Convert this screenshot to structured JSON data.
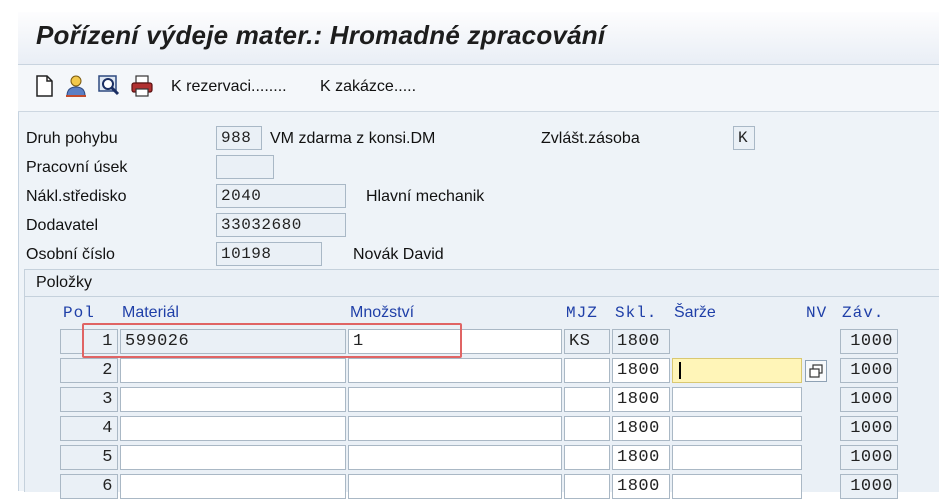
{
  "title": "Pořízení výdeje mater.: Hromadné zpracování",
  "toolbar": {
    "icons": [
      "new-document-icon",
      "person-icon",
      "find-icon",
      "printer-icon"
    ],
    "link_reservation": "K rezervaci........",
    "link_order": "K zakázce....."
  },
  "header": {
    "movement_type": {
      "label": "Druh pohybu",
      "value": "988",
      "text": "VM zdarma z konsi.DM"
    },
    "special_stock": {
      "label": "Zvlášt.zásoba",
      "value": "K"
    },
    "work_section": {
      "label": "Pracovní úsek",
      "value": ""
    },
    "cost_center": {
      "label": "Nákl.středisko",
      "value": "2040",
      "text": "Hlavní mechanik"
    },
    "supplier": {
      "label": "Dodavatel",
      "value": "33032680"
    },
    "personnel_no": {
      "label": "Osobní číslo",
      "value": "10198",
      "text": "Novák David"
    }
  },
  "items": {
    "group_title": "Položky",
    "columns": {
      "pol": "Pol",
      "material": "Materiál",
      "quantity": "Množství",
      "uom": "MJZ",
      "storage": "Skl.",
      "batch": "Šarže",
      "nv": "NV",
      "plant": "Záv."
    },
    "rows": [
      {
        "pol": "1",
        "material": "599026",
        "quantity": "1",
        "uom": "KS",
        "storage": "1800",
        "batch": "",
        "plant": "1000"
      },
      {
        "pol": "2",
        "material": "",
        "quantity": "",
        "uom": "",
        "storage": "1800",
        "batch": "",
        "plant": "1000"
      },
      {
        "pol": "3",
        "material": "",
        "quantity": "",
        "uom": "",
        "storage": "1800",
        "batch": "",
        "plant": "1000"
      },
      {
        "pol": "4",
        "material": "",
        "quantity": "",
        "uom": "",
        "storage": "1800",
        "batch": "",
        "plant": "1000"
      },
      {
        "pol": "5",
        "material": "",
        "quantity": "",
        "uom": "",
        "storage": "1800",
        "batch": "",
        "plant": "1000"
      },
      {
        "pol": "6",
        "material": "",
        "quantity": "",
        "uom": "",
        "storage": "1800",
        "batch": "",
        "plant": "1000"
      }
    ]
  },
  "colors": {
    "header_blue": "#1f3fa8",
    "highlight": "#e06464",
    "focus_field": "#fff5b8"
  }
}
